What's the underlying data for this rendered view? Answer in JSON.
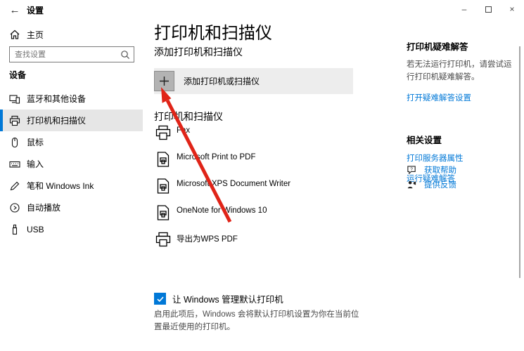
{
  "titlebar": {
    "title": "设置",
    "back_glyph": "←",
    "minimize_glyph": "–",
    "close_glyph": "×"
  },
  "sidebar": {
    "home_label": "主页",
    "search_placeholder": "查找设置",
    "section_label": "设备",
    "items": [
      {
        "label": "蓝牙和其他设备"
      },
      {
        "label": "打印机和扫描仪",
        "selected": true
      },
      {
        "label": "鼠标"
      },
      {
        "label": "输入"
      },
      {
        "label": "笔和 Windows Ink"
      },
      {
        "label": "自动播放"
      },
      {
        "label": "USB"
      }
    ]
  },
  "main": {
    "page_title": "打印机和扫描仪",
    "add_section_title": "添加打印机和扫描仪",
    "add_button_label": "添加打印机或扫描仪",
    "add_button_plus": "+",
    "list_section_title": "打印机和扫描仪",
    "printers": [
      {
        "name": "Fax"
      },
      {
        "name": "Microsoft Print to PDF"
      },
      {
        "name": "Microsoft XPS Document Writer"
      },
      {
        "name": "OneNote for Windows 10"
      },
      {
        "name": "导出为WPS PDF"
      }
    ],
    "default_printer": {
      "checked": true,
      "label": "让 Windows 管理默认打印机",
      "description": "启用此项后，Windows 会将默认打印机设置为你在当前位置最近使用的打印机。"
    }
  },
  "right_panel": {
    "troubleshoot_title": "打印机疑难解答",
    "troubleshoot_text": "若无法运行打印机，请尝试运行打印机疑难解答。",
    "troubleshoot_link": "打开疑难解答设置",
    "related_title": "相关设置",
    "related_link_1": "打印服务器属性",
    "related_link_2": "运行疑难解答",
    "help_link": "获取帮助",
    "feedback_link": "提供反馈"
  },
  "colors": {
    "accent": "#0078d7",
    "link": "#0078d7",
    "selected_bg": "#e6e6e6",
    "add_row_bg": "#ededed",
    "annotation_arrow": "#e02418"
  }
}
